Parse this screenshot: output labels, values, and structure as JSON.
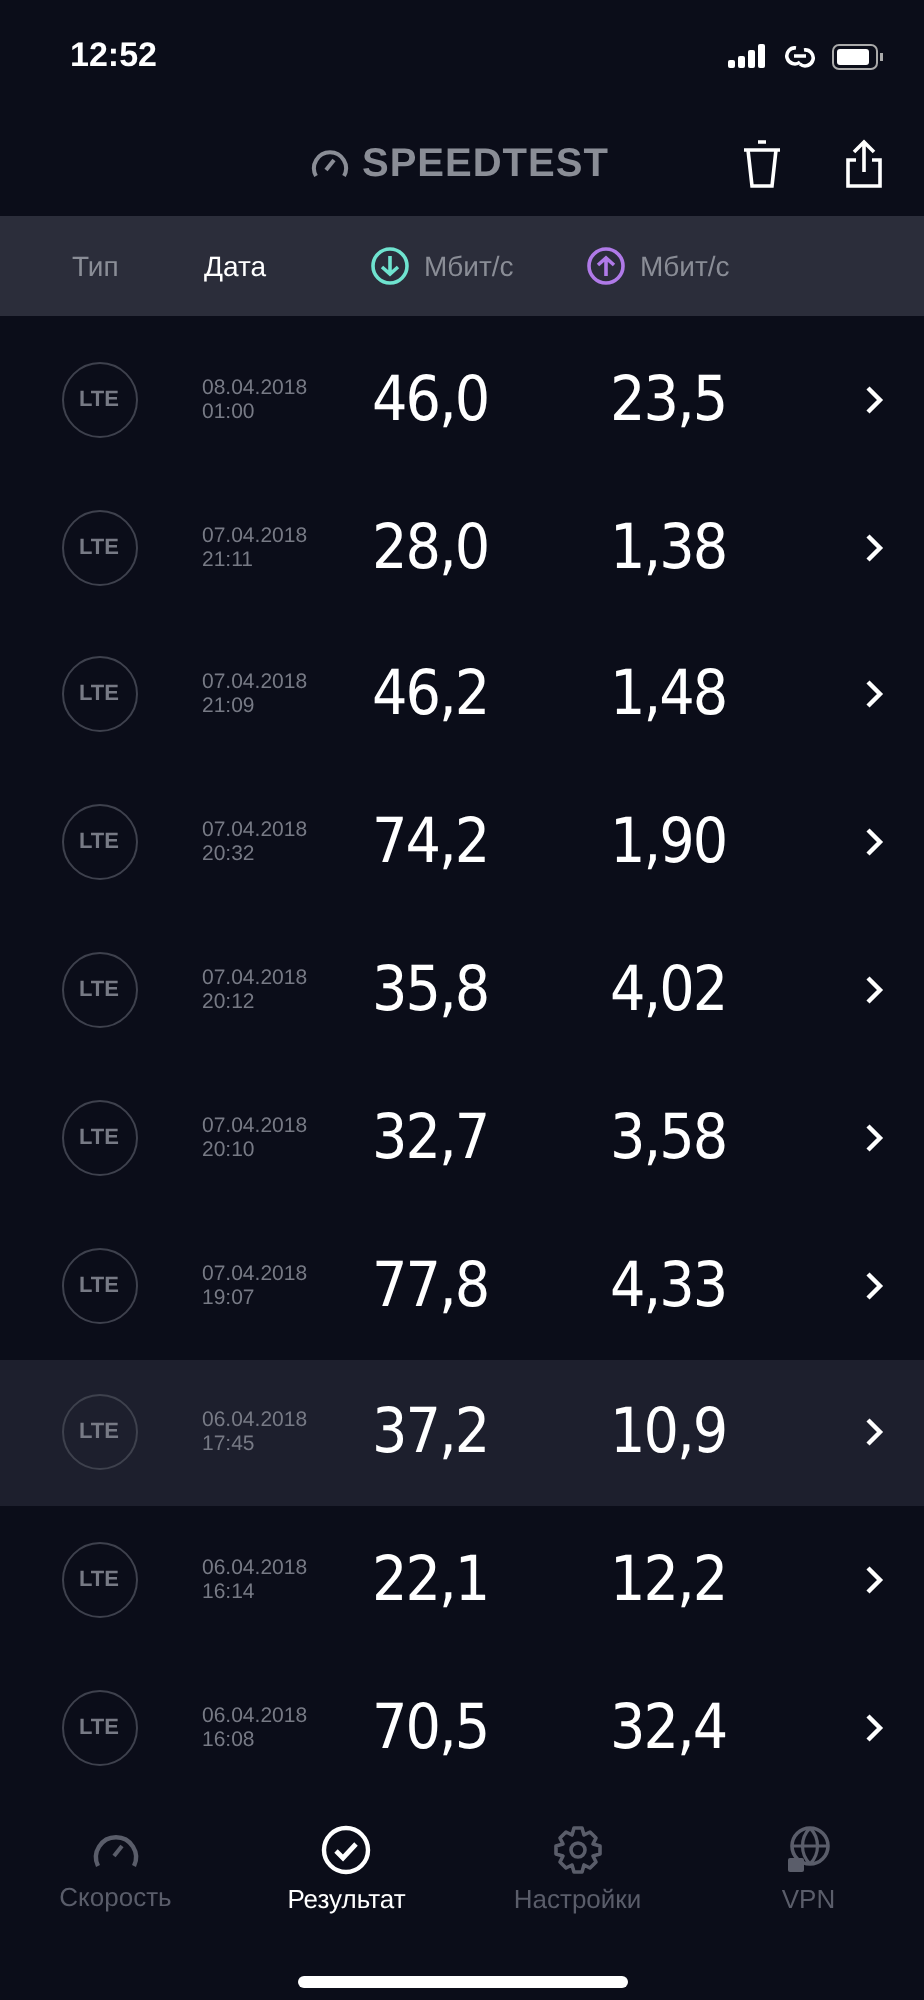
{
  "status_bar": {
    "time": "12:52"
  },
  "header": {
    "logo": "SPEEDTEST"
  },
  "columns": [
    {
      "label": "Тип",
      "kind": "text",
      "selected": false
    },
    {
      "label": "Дата",
      "kind": "text",
      "selected": true
    },
    {
      "label": "Мбит/с",
      "kind": "download",
      "selected": false
    },
    {
      "label": "Мбит/с",
      "kind": "upload",
      "selected": false
    }
  ],
  "rows": [
    {
      "type": "LTE",
      "date": "08.04.2018",
      "time": "01:00",
      "download": "46,0",
      "upload": "23,5",
      "selected": false
    },
    {
      "type": "LTE",
      "date": "07.04.2018",
      "time": "21:11",
      "download": "28,0",
      "upload": "1,38",
      "selected": false
    },
    {
      "type": "LTE",
      "date": "07.04.2018",
      "time": "21:09",
      "download": "46,2",
      "upload": "1,48",
      "selected": false
    },
    {
      "type": "LTE",
      "date": "07.04.2018",
      "time": "20:32",
      "download": "74,2",
      "upload": "1,90",
      "selected": false
    },
    {
      "type": "LTE",
      "date": "07.04.2018",
      "time": "20:12",
      "download": "35,8",
      "upload": "4,02",
      "selected": false
    },
    {
      "type": "LTE",
      "date": "07.04.2018",
      "time": "20:10",
      "download": "32,7",
      "upload": "3,58",
      "selected": false
    },
    {
      "type": "LTE",
      "date": "07.04.2018",
      "time": "19:07",
      "download": "77,8",
      "upload": "4,33",
      "selected": false
    },
    {
      "type": "LTE",
      "date": "06.04.2018",
      "time": "17:45",
      "download": "37,2",
      "upload": "10,9",
      "selected": true
    },
    {
      "type": "LTE",
      "date": "06.04.2018",
      "time": "16:14",
      "download": "22,1",
      "upload": "12,2",
      "selected": false
    },
    {
      "type": "LTE",
      "date": "06.04.2018",
      "time": "16:08",
      "download": "70,5",
      "upload": "32,4",
      "selected": false
    }
  ],
  "tabs": [
    {
      "label": "Скорость",
      "kind": "speed",
      "selected": false
    },
    {
      "label": "Результат",
      "kind": "results",
      "selected": true
    },
    {
      "label": "Настройки",
      "kind": "settings",
      "selected": false
    },
    {
      "label": "VPN",
      "kind": "vpn",
      "selected": false
    }
  ]
}
